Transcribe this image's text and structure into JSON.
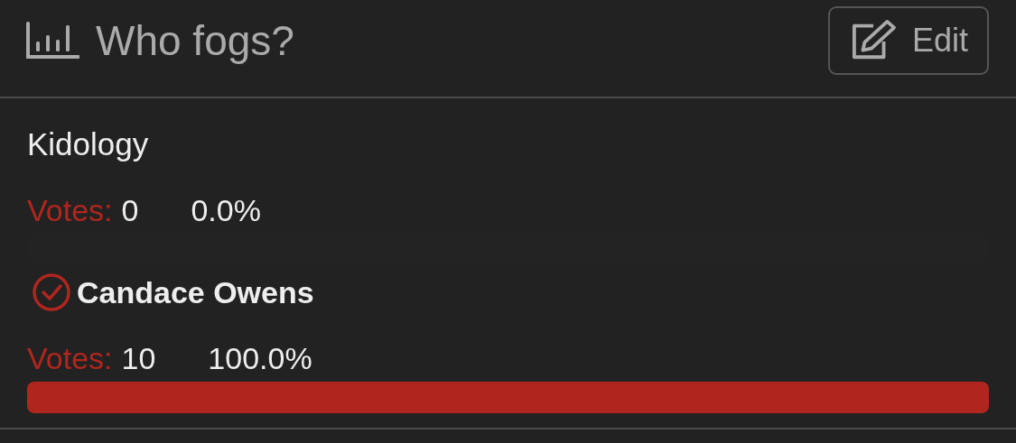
{
  "poll": {
    "title": "Who fogs?",
    "edit_button": "Edit"
  },
  "options": [
    {
      "name": "Kidology",
      "selected": false,
      "votes_label": "Votes:",
      "votes": "0",
      "percent": "0.0%",
      "level": 0
    },
    {
      "name": "Candace Owens",
      "selected": true,
      "votes_label": "Votes:",
      "votes": "10",
      "percent": "100.0%",
      "level": 1
    }
  ]
}
